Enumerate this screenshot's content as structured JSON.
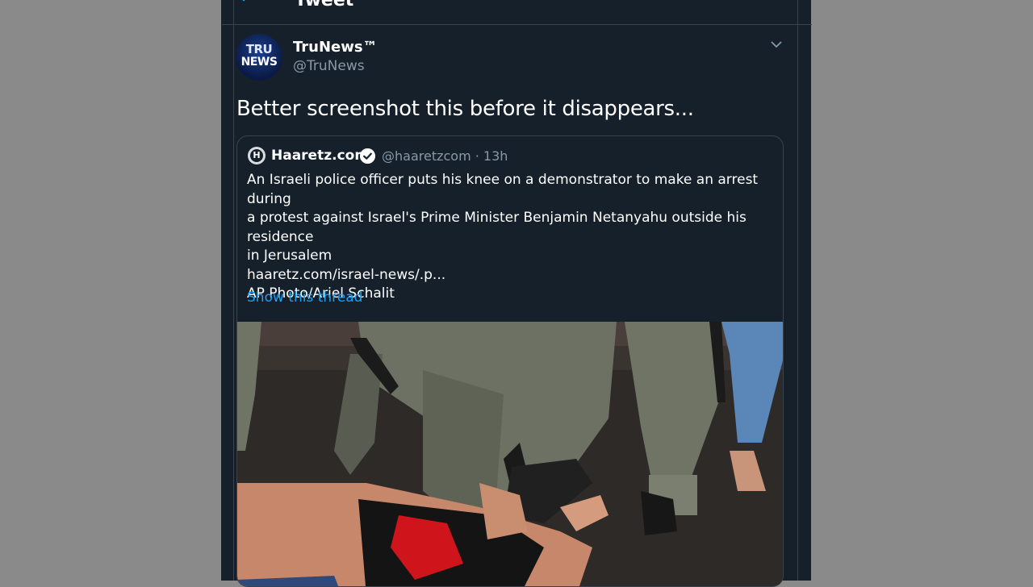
{
  "header": {
    "title": "Tweet"
  },
  "tweet": {
    "author": {
      "name": "TruNews™",
      "handle": "@TruNews",
      "avatar_text_line1": "TRU",
      "avatar_text_line2": "NEWS"
    },
    "text": "Better screenshot this before it disappears..."
  },
  "quote": {
    "author_name": "Haaretz.com",
    "handle_time": "@haaretzcom · 13h",
    "logo_text": "H",
    "body_lines": [
      "An Israeli police officer puts his knee on a demonstrator to make an arrest during",
      "a protest against Israel's Prime Minister Benjamin Netanyahu outside his residence",
      "in Jerusalem"
    ],
    "link": "haaretz.com/israel-news/.p...",
    "photo_credit": "AP Photo/Ariel Schalit",
    "show_thread": "Show this thread"
  },
  "colors": {
    "background": "#15202b",
    "accent": "#1da1f2",
    "secondary_text": "#8899a6",
    "border": "#38444d"
  }
}
